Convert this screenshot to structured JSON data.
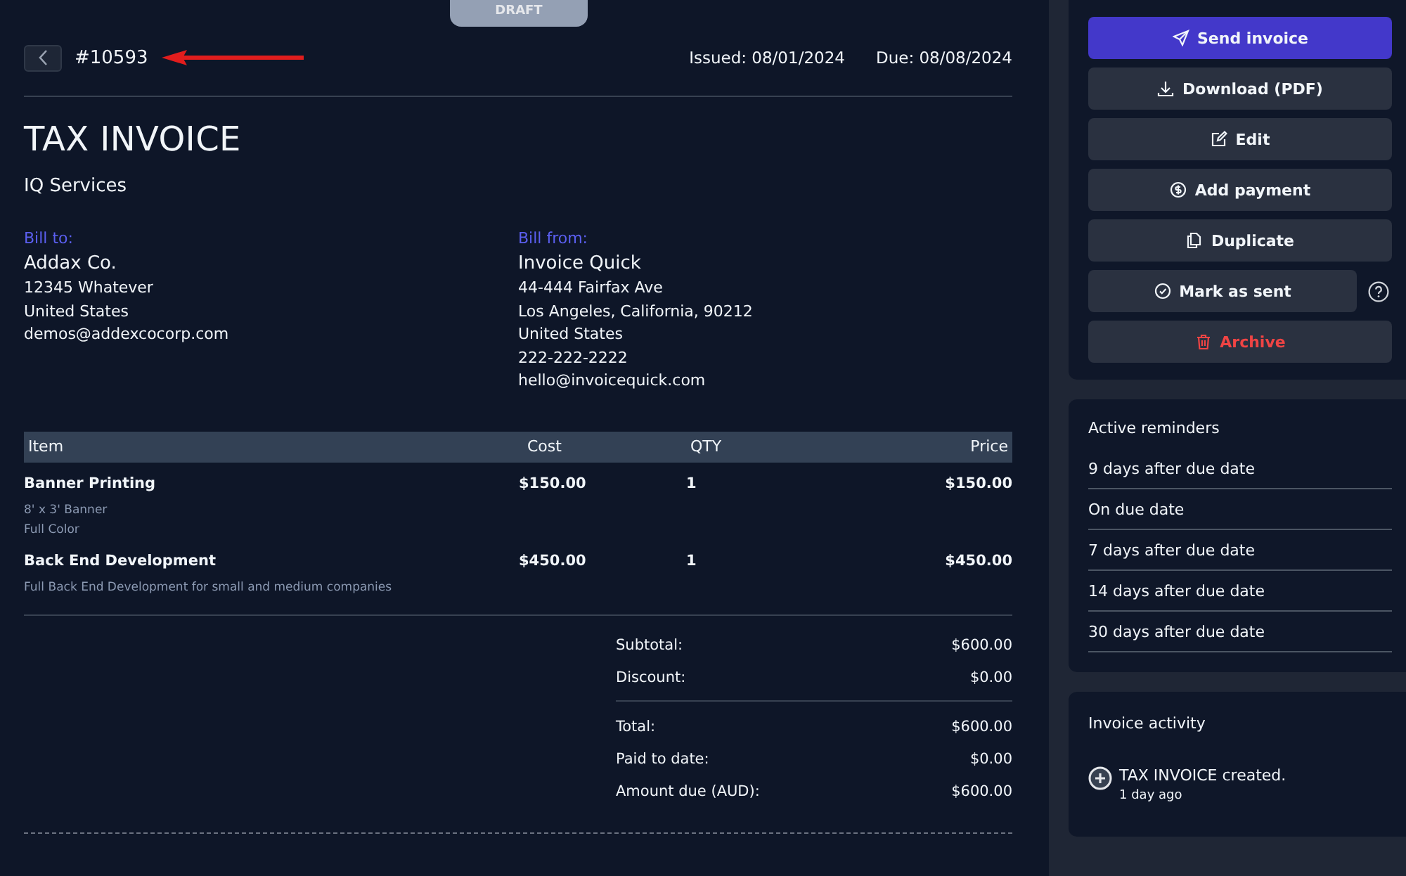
{
  "status_badge": "DRAFT",
  "invoice_number": "#10593",
  "issued": "Issued: 08/01/2024",
  "due": "Due: 08/08/2024",
  "title": "TAX INVOICE",
  "company": "IQ Services",
  "bill_to": {
    "label": "Bill to:",
    "name": "Addax Co.",
    "lines": [
      "12345 Whatever",
      "United States",
      "demos@addexcocorp.com"
    ]
  },
  "bill_from": {
    "label": "Bill from:",
    "name": "Invoice Quick",
    "lines": [
      "44-444 Fairfax Ave",
      "Los Angeles, California, 90212",
      "United States",
      "222-222-2222",
      "hello@invoicequick.com"
    ]
  },
  "table": {
    "columns": [
      "Item",
      "Cost",
      "QTY",
      "Price"
    ],
    "rows": [
      {
        "item": "Banner Printing",
        "cost": "$150.00",
        "qty": "1",
        "price": "$150.00",
        "notes": [
          "8' x 3' Banner",
          "Full Color"
        ]
      },
      {
        "item": "Back End Development",
        "cost": "$450.00",
        "qty": "1",
        "price": "$450.00",
        "notes": [
          "Full Back End Development for small and medium companies"
        ]
      }
    ]
  },
  "totals": [
    [
      {
        "label": "Subtotal:",
        "value": "$600.00"
      },
      {
        "label": "Discount:",
        "value": "$0.00"
      }
    ],
    [
      {
        "label": "Total:",
        "value": "$600.00"
      },
      {
        "label": "Paid to date:",
        "value": "$0.00"
      },
      {
        "label": "Amount due (AUD):",
        "value": "$600.00"
      }
    ]
  ],
  "actions": [
    {
      "label": "Send invoice",
      "kind": "primary"
    },
    {
      "label": "Download (PDF)",
      "kind": "default"
    },
    {
      "label": "Edit",
      "kind": "default"
    },
    {
      "label": "Add payment",
      "kind": "default"
    },
    {
      "label": "Duplicate",
      "kind": "default"
    },
    {
      "label": "Mark as sent",
      "kind": "default"
    },
    {
      "label": "Archive",
      "kind": "danger"
    }
  ],
  "reminders": {
    "title": "Active reminders",
    "items": [
      "9 days after due date",
      "On due date",
      "7 days after due date",
      "14 days after due date",
      "30 days after due date"
    ]
  },
  "activity": {
    "title": "Invoice activity",
    "items": [
      {
        "text": "TAX INVOICE created.",
        "time": "1 day ago"
      }
    ]
  }
}
